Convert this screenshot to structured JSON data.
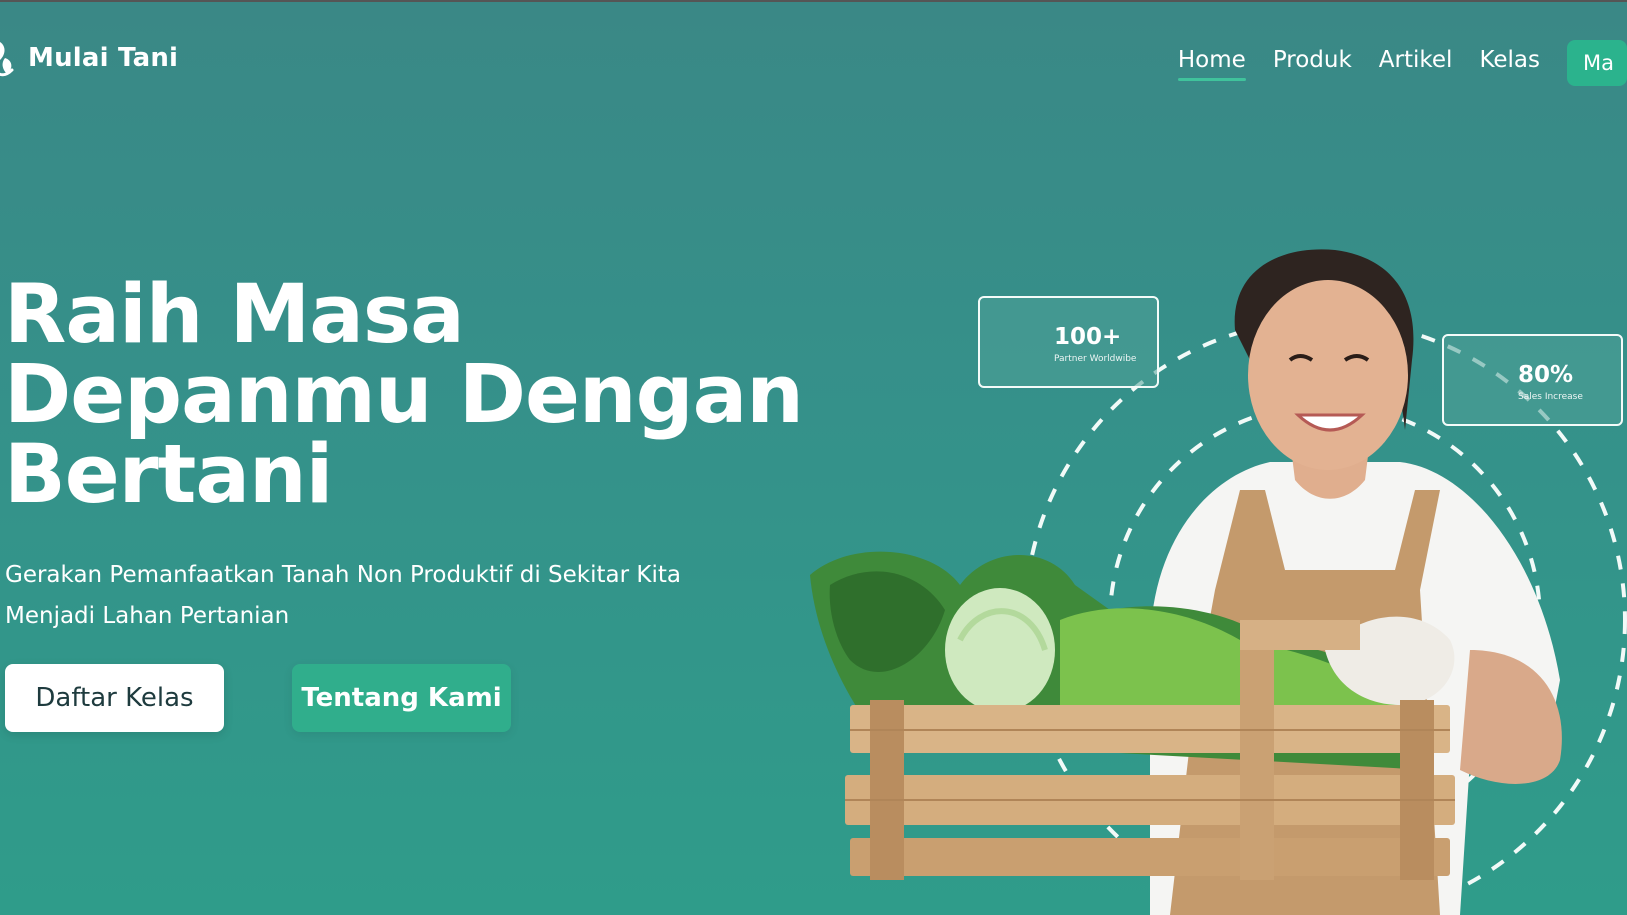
{
  "brand": {
    "name": "Mulai Tani"
  },
  "nav": {
    "items": [
      {
        "label": "Home",
        "active": true
      },
      {
        "label": "Produk",
        "active": false
      },
      {
        "label": "Artikel",
        "active": false
      },
      {
        "label": "Kelas",
        "active": false
      }
    ],
    "cta_label": "Ma"
  },
  "hero": {
    "title_lines": [
      "Raih Masa",
      "Depanmu Dengan",
      "Bertani"
    ],
    "subtitle_lines": [
      "Gerakan Pemanfaatkan Tanah Non Produktif di Sekitar Kita",
      "Menjadi Lahan Pertanian"
    ],
    "primary_button": "Daftar Kelas",
    "secondary_button": "Tentang Kami"
  },
  "stats": [
    {
      "value": "100+",
      "label": "Partner Worldwibe"
    },
    {
      "value": "80%",
      "label": "Sales Increase"
    }
  ],
  "colors": {
    "background_top": "#3a8886",
    "background_bottom": "#2f9c8a",
    "accent": "#2bb38d",
    "nav_underline": "#40c39c",
    "primary_button_text": "#1e3b3e"
  }
}
